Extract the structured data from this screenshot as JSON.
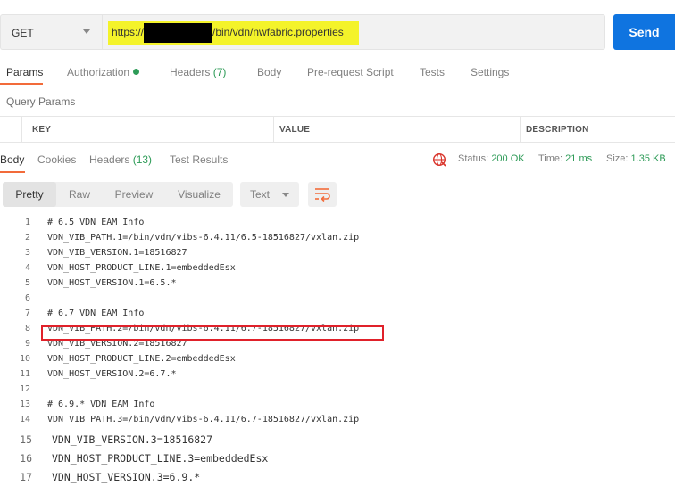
{
  "request": {
    "method": "GET",
    "url_prefix": "https://",
    "url_suffix": "/bin/vdn/nwfabric.properties",
    "send_label": "Send"
  },
  "request_tabs": [
    {
      "label": "Params",
      "count": ""
    },
    {
      "label": "Authorization",
      "count": ""
    },
    {
      "label": "Headers",
      "count": "(7)"
    },
    {
      "label": "Body",
      "count": ""
    },
    {
      "label": "Pre-request Script",
      "count": ""
    },
    {
      "label": "Tests",
      "count": ""
    },
    {
      "label": "Settings",
      "count": ""
    }
  ],
  "query_params": {
    "title": "Query Params",
    "columns": [
      "KEY",
      "VALUE",
      "DESCRIPTION"
    ]
  },
  "response_tabs": [
    {
      "label": "Body",
      "count": ""
    },
    {
      "label": "Cookies",
      "count": ""
    },
    {
      "label": "Headers",
      "count": "(13)"
    },
    {
      "label": "Test Results",
      "count": ""
    }
  ],
  "response_status": {
    "status_label": "Status:",
    "status_value": "200 OK",
    "time_label": "Time:",
    "time_value": "21 ms",
    "size_label": "Size:",
    "size_value": "1.35 KB"
  },
  "format_toolbar": {
    "buttons": [
      "Pretty",
      "Raw",
      "Preview",
      "Visualize"
    ],
    "type_select": "Text"
  },
  "code_lines": [
    {
      "n": "1",
      "t": "# 6.5 VDN EAM Info"
    },
    {
      "n": "2",
      "t": "VDN_VIB_PATH.1=/bin/vdn/vibs-6.4.11/6.5-18516827/vxlan.zip"
    },
    {
      "n": "3",
      "t": "VDN_VIB_VERSION.1=18516827"
    },
    {
      "n": "4",
      "t": "VDN_HOST_PRODUCT_LINE.1=embeddedEsx"
    },
    {
      "n": "5",
      "t": "VDN_HOST_VERSION.1=6.5.*"
    },
    {
      "n": "6",
      "t": ""
    },
    {
      "n": "7",
      "t": "# 6.7 VDN EAM Info"
    },
    {
      "n": "8",
      "t": "VDN_VIB_PATH.2=/bin/vdn/vibs-6.4.11/6.7-18516827/vxlan.zip"
    },
    {
      "n": "9",
      "t": "VDN_VIB_VERSION.2=18516827"
    },
    {
      "n": "10",
      "t": "VDN_HOST_PRODUCT_LINE.2=embeddedEsx"
    },
    {
      "n": "11",
      "t": "VDN_HOST_VERSION.2=6.7.*"
    },
    {
      "n": "12",
      "t": ""
    },
    {
      "n": "13",
      "t": "# 6.9.* VDN EAM Info"
    },
    {
      "n": "14",
      "t": "VDN_VIB_PATH.3=/bin/vdn/vibs-6.4.11/6.7-18516827/vxlan.zip"
    },
    {
      "n": "15",
      "t": "VDN_VIB_VERSION.3=18516827"
    },
    {
      "n": "16",
      "t": "VDN_HOST_PRODUCT_LINE.3=embeddedEsx"
    },
    {
      "n": "17",
      "t": "VDN_HOST_VERSION.3=6.9.*"
    }
  ],
  "colors": {
    "accent": "#f26b3a",
    "send": "#0f74e0",
    "status_ok": "#2d9b57",
    "url_highlight": "#f4f32a",
    "annotation_box": "#e0212a"
  }
}
